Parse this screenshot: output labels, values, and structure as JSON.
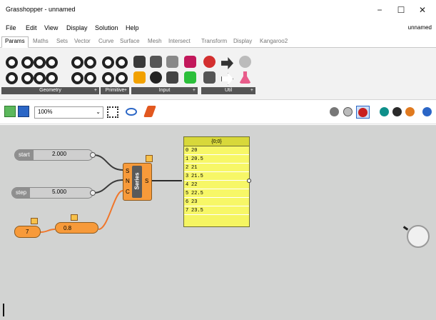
{
  "window": {
    "title": "Grasshopper - unnamed",
    "minimize": "−",
    "maximize": "☐",
    "close": "✕"
  },
  "menu": {
    "items": [
      "File",
      "Edit",
      "View",
      "Display",
      "Solution",
      "Help"
    ],
    "doc_name": "unnamed"
  },
  "tabs": [
    "Params",
    "Maths",
    "Sets",
    "Vector",
    "Curve",
    "Surface",
    "Mesh",
    "Intersect",
    "Transform",
    "Display",
    "Kangaroo2"
  ],
  "active_tab": "Params",
  "ribbon_groups": [
    {
      "label": "Geometry",
      "plus": "+"
    },
    {
      "label": "Primitive",
      "plus": "+"
    },
    {
      "label": "Input",
      "plus": "+"
    },
    {
      "label": "Util",
      "plus": "+"
    }
  ],
  "toolbar": {
    "zoom": "100%",
    "zoom_arrow": "⌄"
  },
  "sliders": [
    {
      "label": "start",
      "value": "2.000"
    },
    {
      "label": "step",
      "value": "5.000"
    }
  ],
  "number_nodes": {
    "count": "7",
    "factor": "0.8"
  },
  "series": {
    "title": "Series",
    "inputs": [
      "S",
      "N",
      "C"
    ],
    "output": "S"
  },
  "panel": {
    "header": "{0;0}",
    "rows": [
      {
        "index": "0",
        "value": "20"
      },
      {
        "index": "1",
        "value": "20.5"
      },
      {
        "index": "2",
        "value": "21"
      },
      {
        "index": "3",
        "value": "21.5"
      },
      {
        "index": "4",
        "value": "22"
      },
      {
        "index": "5",
        "value": "22.5"
      },
      {
        "index": "6",
        "value": "23"
      },
      {
        "index": "7",
        "value": "23.5"
      }
    ]
  }
}
